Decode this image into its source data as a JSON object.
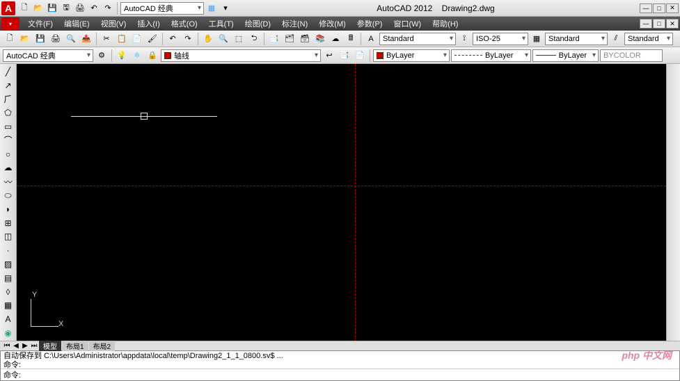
{
  "app": {
    "name": "AutoCAD 2012",
    "document": "Drawing2.dwg",
    "logo_letter": "A"
  },
  "quick_access": {
    "search_placeholder": ""
  },
  "workspace_selector": "AutoCAD 经典",
  "menus": [
    "文件(F)",
    "编辑(E)",
    "视图(V)",
    "插入(I)",
    "格式(O)",
    "工具(T)",
    "绘图(D)",
    "标注(N)",
    "修改(M)",
    "参数(P)",
    "窗口(W)",
    "帮助(H)"
  ],
  "toolbar1": {
    "text_style": "Standard",
    "dim_style": "ISO-25",
    "table_style": "Standard",
    "mline_style": "Standard"
  },
  "toolbar2": {
    "workspace": "AutoCAD 经典",
    "layer_name": "轴线",
    "layer_color_swatch": "#cc0000",
    "color_control": "ByLayer",
    "color_swatch": "#cc0000",
    "linetype": "ByLayer",
    "lineweight": "ByLayer",
    "plotstyle": "BYCOLOR"
  },
  "tabs": {
    "items": [
      "模型",
      "布局1",
      "布局2"
    ],
    "active": 0
  },
  "ucs": {
    "x": "X",
    "y": "Y"
  },
  "command": {
    "history_line1": "自动保存到 C:\\Users\\Administrator\\appdata\\local\\temp\\Drawing2_1_1_0800.sv$ ...",
    "history_line2": "命令:",
    "prompt": "命令:"
  },
  "watermark": "php 中文网"
}
